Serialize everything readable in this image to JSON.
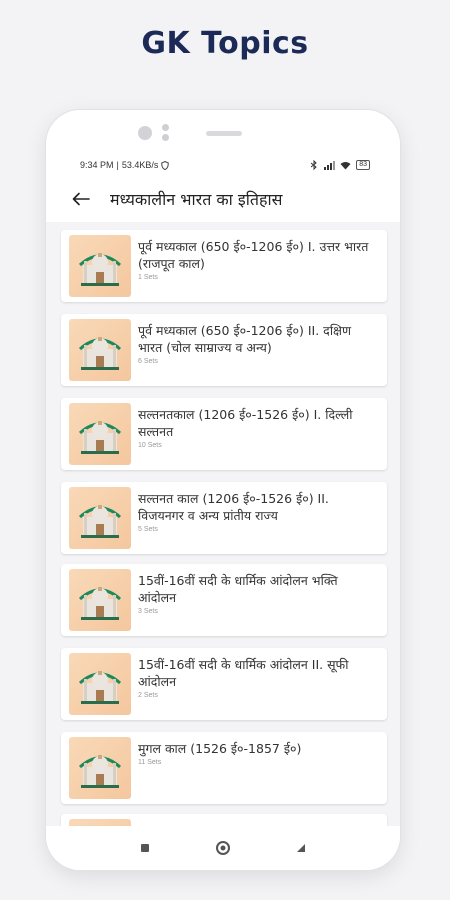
{
  "banner": {
    "title": "GK Topics"
  },
  "status_bar": {
    "time": "9:34 PM",
    "speed": "53.4KB/s",
    "battery": "83"
  },
  "app_bar": {
    "title": "मध्यकालीन भारत का इतिहास"
  },
  "topics": [
    {
      "title": "पूर्व मध्यकाल (650 ई०-1206 ई०) I. उत्तर भारत (राजपूत काल)",
      "sets": "1 Sets"
    },
    {
      "title": "पूर्व मध्यकाल (650 ई०-1206 ई०) II. दक्षिण भारत (चोल साम्राज्य व अन्य)",
      "sets": "6 Sets"
    },
    {
      "title": "सल्तनतकाल (1206 ई०-1526 ई०) I. दिल्ली सल्तनत",
      "sets": "10 Sets"
    },
    {
      "title": "सल्तनत काल (1206 ई०-1526 ई०) II. विजयनगर व अन्य प्रांतीय राज्य",
      "sets": "5 Sets"
    },
    {
      "title": "15वीं-16वीं सदी के धार्मिक आंदोलन भक्ति आंदोलन",
      "sets": "3 Sets"
    },
    {
      "title": "15वीं-16वीं सदी के धार्मिक आंदोलन II. सूफी आंदोलन",
      "sets": "2 Sets"
    },
    {
      "title": "मुगल काल (1526 ई०-1857 ई०)",
      "sets": "11 Sets"
    },
    {
      "title": "",
      "sets": ""
    }
  ],
  "colors": {
    "accent_orange": "#f4c79e",
    "banner_text": "#1b2a56",
    "dome_green": "#1e8a5c"
  },
  "icons": {
    "back": "arrow-left-icon",
    "thumbnail": "taj-mahal-icon",
    "nav_back": "triangle-back-icon",
    "nav_home": "circle-home-icon",
    "nav_recents": "square-recents-icon"
  }
}
